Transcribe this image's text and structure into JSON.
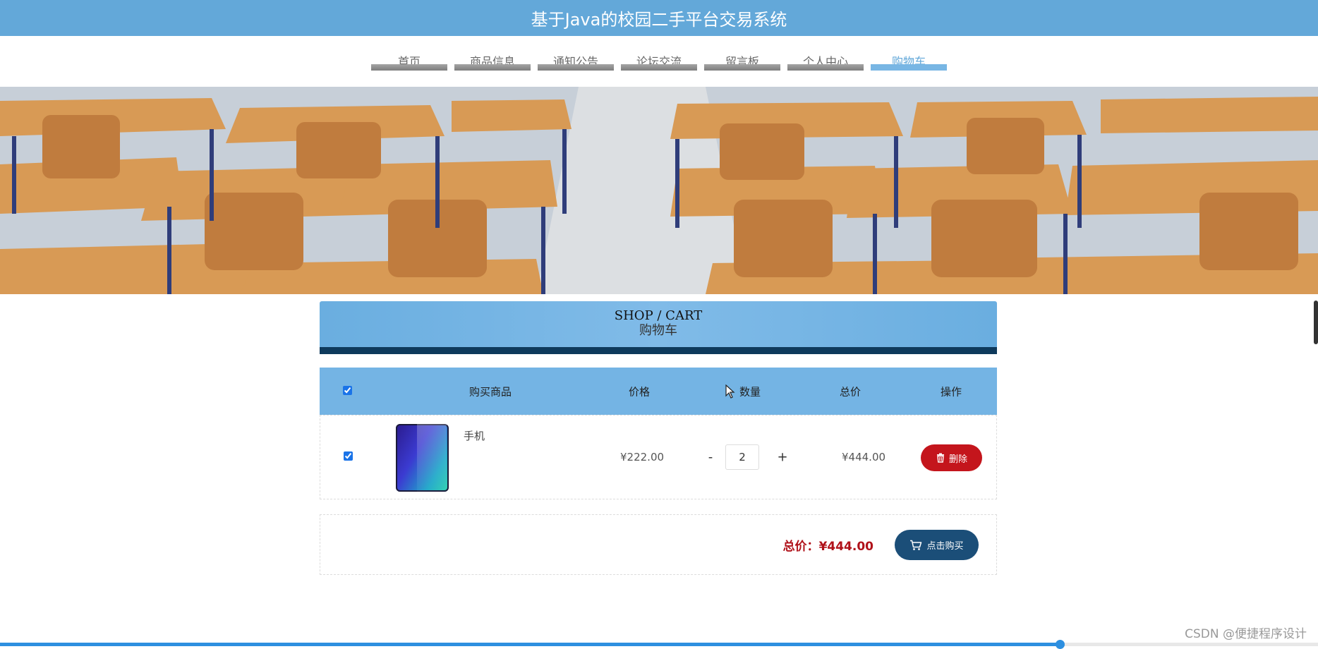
{
  "header": {
    "title": "基于Java的校园二手平台交易系统"
  },
  "nav": {
    "items": [
      {
        "label": "首页"
      },
      {
        "label": "商品信息"
      },
      {
        "label": "通知公告"
      },
      {
        "label": "论坛交流"
      },
      {
        "label": "留言板"
      },
      {
        "label": "个人中心"
      },
      {
        "label": "购物车"
      }
    ],
    "active_index": 6
  },
  "banner": {
    "icon": "classroom-photo"
  },
  "cart_header": {
    "en": "SHOP / CART",
    "zh": "购物车"
  },
  "table": {
    "columns": [
      "购买商品",
      "价格",
      "数量",
      "总价",
      "操作"
    ],
    "select_all_checked": true,
    "rows": [
      {
        "checked": true,
        "name": "手机",
        "image_icon": "phone-product-image",
        "price": "¥222.00",
        "qty_minus": "-",
        "quantity": "2",
        "qty_plus": "+",
        "subtotal": "¥444.00",
        "delete_label": "删除"
      }
    ]
  },
  "summary": {
    "total_label": "总价：",
    "total_value": "¥444.00",
    "buy_label": "点击购买"
  },
  "colors": {
    "header_bg": "#63a8d9",
    "delete_btn": "#c4151c",
    "buy_btn": "#1b4e78",
    "total_text": "#b0121a"
  },
  "progress": {
    "value": 0.804
  },
  "watermark": "CSDN @便捷程序设计"
}
